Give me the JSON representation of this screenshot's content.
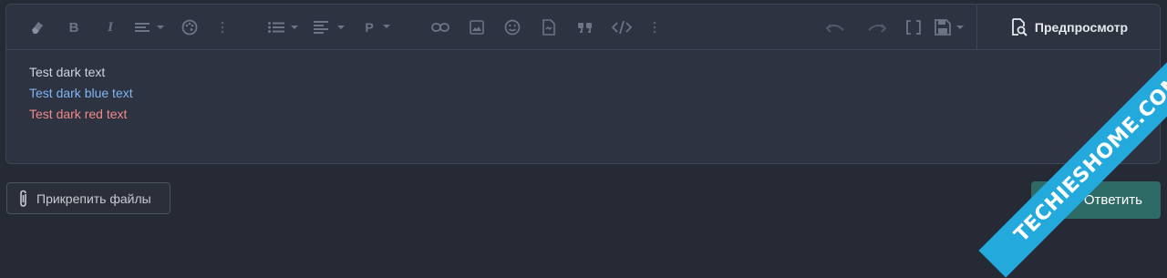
{
  "toolbar": {
    "icons": [
      "eraser-icon",
      "bold-icon",
      "italic-icon",
      "align-icon",
      "palette-icon",
      "more-vertical-icon",
      "list-icon",
      "paragraph-align-icon",
      "paragraph-icon",
      "link-icon",
      "image-icon",
      "smile-icon",
      "file-icon",
      "quote-icon",
      "code-icon",
      "more-vertical-icon",
      "undo-icon",
      "redo-icon",
      "brackets-icon",
      "save-icon"
    ],
    "bold_label": "B",
    "italic_label": "I",
    "paragraph_label": "P",
    "preview_label": "Предпросмотр"
  },
  "content": {
    "lines": [
      "Test dark text",
      "Test dark blue text",
      "Test dark red text"
    ]
  },
  "footer": {
    "attach_label": "Прикрепить файлы",
    "reply_label": "Ответить"
  },
  "watermark": {
    "text": "TECHIESHOME.COM"
  },
  "colors": {
    "background": "#252a35",
    "editor_bg": "#2d3340",
    "text_blue": "#7fb5f5",
    "text_red": "#f08a8a",
    "reply_bg": "#2e6b66",
    "watermark_bg": "#23a9dc"
  }
}
